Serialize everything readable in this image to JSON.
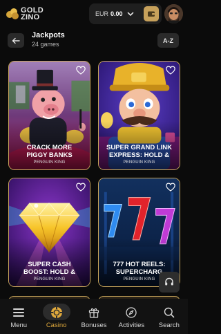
{
  "header": {
    "logo_line1": "GOLD",
    "logo_line2": "ZINO",
    "wallet_currency": "EUR",
    "wallet_amount": "0.00"
  },
  "section": {
    "title": "Jackpots",
    "count": "24 games",
    "sort_label": "A-Z"
  },
  "games": [
    {
      "title_line1": "CRACK MORE",
      "title_line2": "PIGGY BANKS",
      "provider": "PENGUIN KING"
    },
    {
      "title_line1": "SUPER GRAND LINK",
      "title_line2": "EXPRESS: HOLD &",
      "provider": "PENGUIN KING"
    },
    {
      "title_line1": "SUPER CASH",
      "title_line2": "BOOST: HOLD &",
      "provider": "PENGUIN KING"
    },
    {
      "title_line1": "777 HOT REELS:",
      "title_line2": "SUPERCHARG",
      "provider": "PENGUIN KING"
    }
  ],
  "nav": [
    {
      "label": "Menu",
      "icon": "menu-icon"
    },
    {
      "label": "Casino",
      "icon": "casino-chip-icon",
      "active": true
    },
    {
      "label": "Bonuses",
      "icon": "gift-icon"
    },
    {
      "label": "Activities",
      "icon": "compass-icon"
    },
    {
      "label": "Search",
      "icon": "search-icon"
    }
  ],
  "colors": {
    "accent": "#e0a93c",
    "card_border": "#c9a65b",
    "background": "#0b0b0b"
  }
}
